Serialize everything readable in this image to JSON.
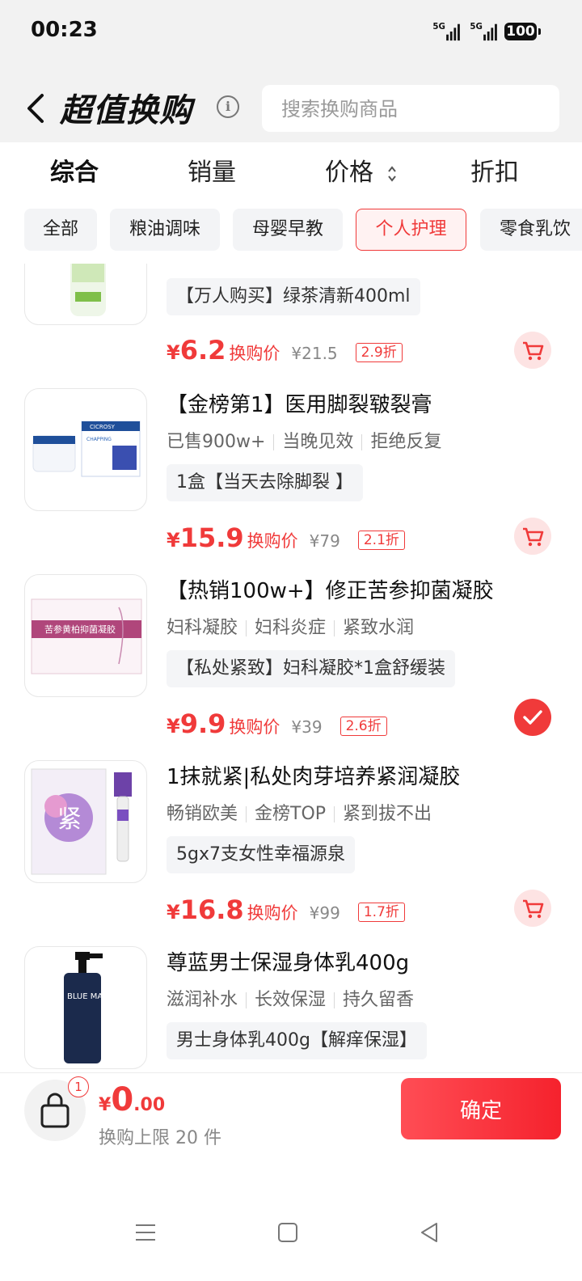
{
  "status": {
    "time": "00:23",
    "network1": "5G",
    "network2": "5G",
    "battery": "100"
  },
  "header": {
    "title": "超值换购",
    "search_placeholder": "搜索换购商品"
  },
  "sort": {
    "tabs": [
      "综合",
      "销量",
      "价格",
      "折扣"
    ],
    "active": "综合"
  },
  "categories": {
    "items": [
      "全部",
      "粮油调味",
      "母婴早教",
      "个人护理",
      "零食乳饮"
    ],
    "active": "个人护理"
  },
  "products": [
    {
      "name": "",
      "tags": [],
      "spec": "【万人购买】绿茶清新400ml",
      "price": "6.2",
      "price_label": "换购价",
      "original": "¥21.5",
      "discount": "2.9折",
      "selected": false
    },
    {
      "name": "【金榜第1】医用脚裂皲裂膏",
      "tags": [
        "已售900w+",
        "当晚见效",
        "拒绝反复"
      ],
      "spec": "1盒【当天去除脚裂 】",
      "price": "15.9",
      "price_label": "换购价",
      "original": "¥79",
      "discount": "2.1折",
      "selected": false
    },
    {
      "name": "【热销100w+】修正苦参抑菌凝胶",
      "tags": [
        "妇科凝胶",
        "妇科炎症",
        "紧致水润"
      ],
      "spec": "【私处紧致】妇科凝胶*1盒舒缓装",
      "price": "9.9",
      "price_label": "换购价",
      "original": "¥39",
      "discount": "2.6折",
      "selected": true
    },
    {
      "name": "1抹就紧|私处肉芽培养紧润凝胶",
      "tags": [
        "畅销欧美",
        "金榜TOP",
        "紧到拔不出"
      ],
      "spec": "5gx7支女性幸福源泉",
      "price": "16.8",
      "price_label": "换购价",
      "original": "¥99",
      "discount": "1.7折",
      "selected": false
    },
    {
      "name": "尊蓝男士保湿身体乳400g",
      "tags": [
        "滋润补水",
        "长效保湿",
        "持久留香"
      ],
      "spec": "男士身体乳400g【解痒保湿】",
      "price": "",
      "price_label": "",
      "original": "",
      "discount": "",
      "selected": false
    }
  ],
  "product_images": {
    "p2_box_text": "CICROSY",
    "p2_box_sub": "CHAPPING",
    "p3_box_text": "苦参黄柏抑菌凝胶",
    "p4_box_text": "紧",
    "p5_brand": "BLUE MAN"
  },
  "bottom": {
    "badge": "1",
    "currency": "¥",
    "total_int": "0",
    "total_dec": ".00",
    "limit": "换购上限 20 件",
    "confirm": "确定"
  },
  "colors": {
    "accent": "#f03a3a",
    "chip_bg": "#f3f4f6",
    "header_bg": "#f2f2f2"
  },
  "icons": [
    "back-icon",
    "info-icon",
    "sort-arrows-icon",
    "cart-icon",
    "check-icon",
    "arrow-up-icon",
    "basket-icon",
    "menu-icon",
    "home-icon",
    "back-triangle-icon"
  ]
}
